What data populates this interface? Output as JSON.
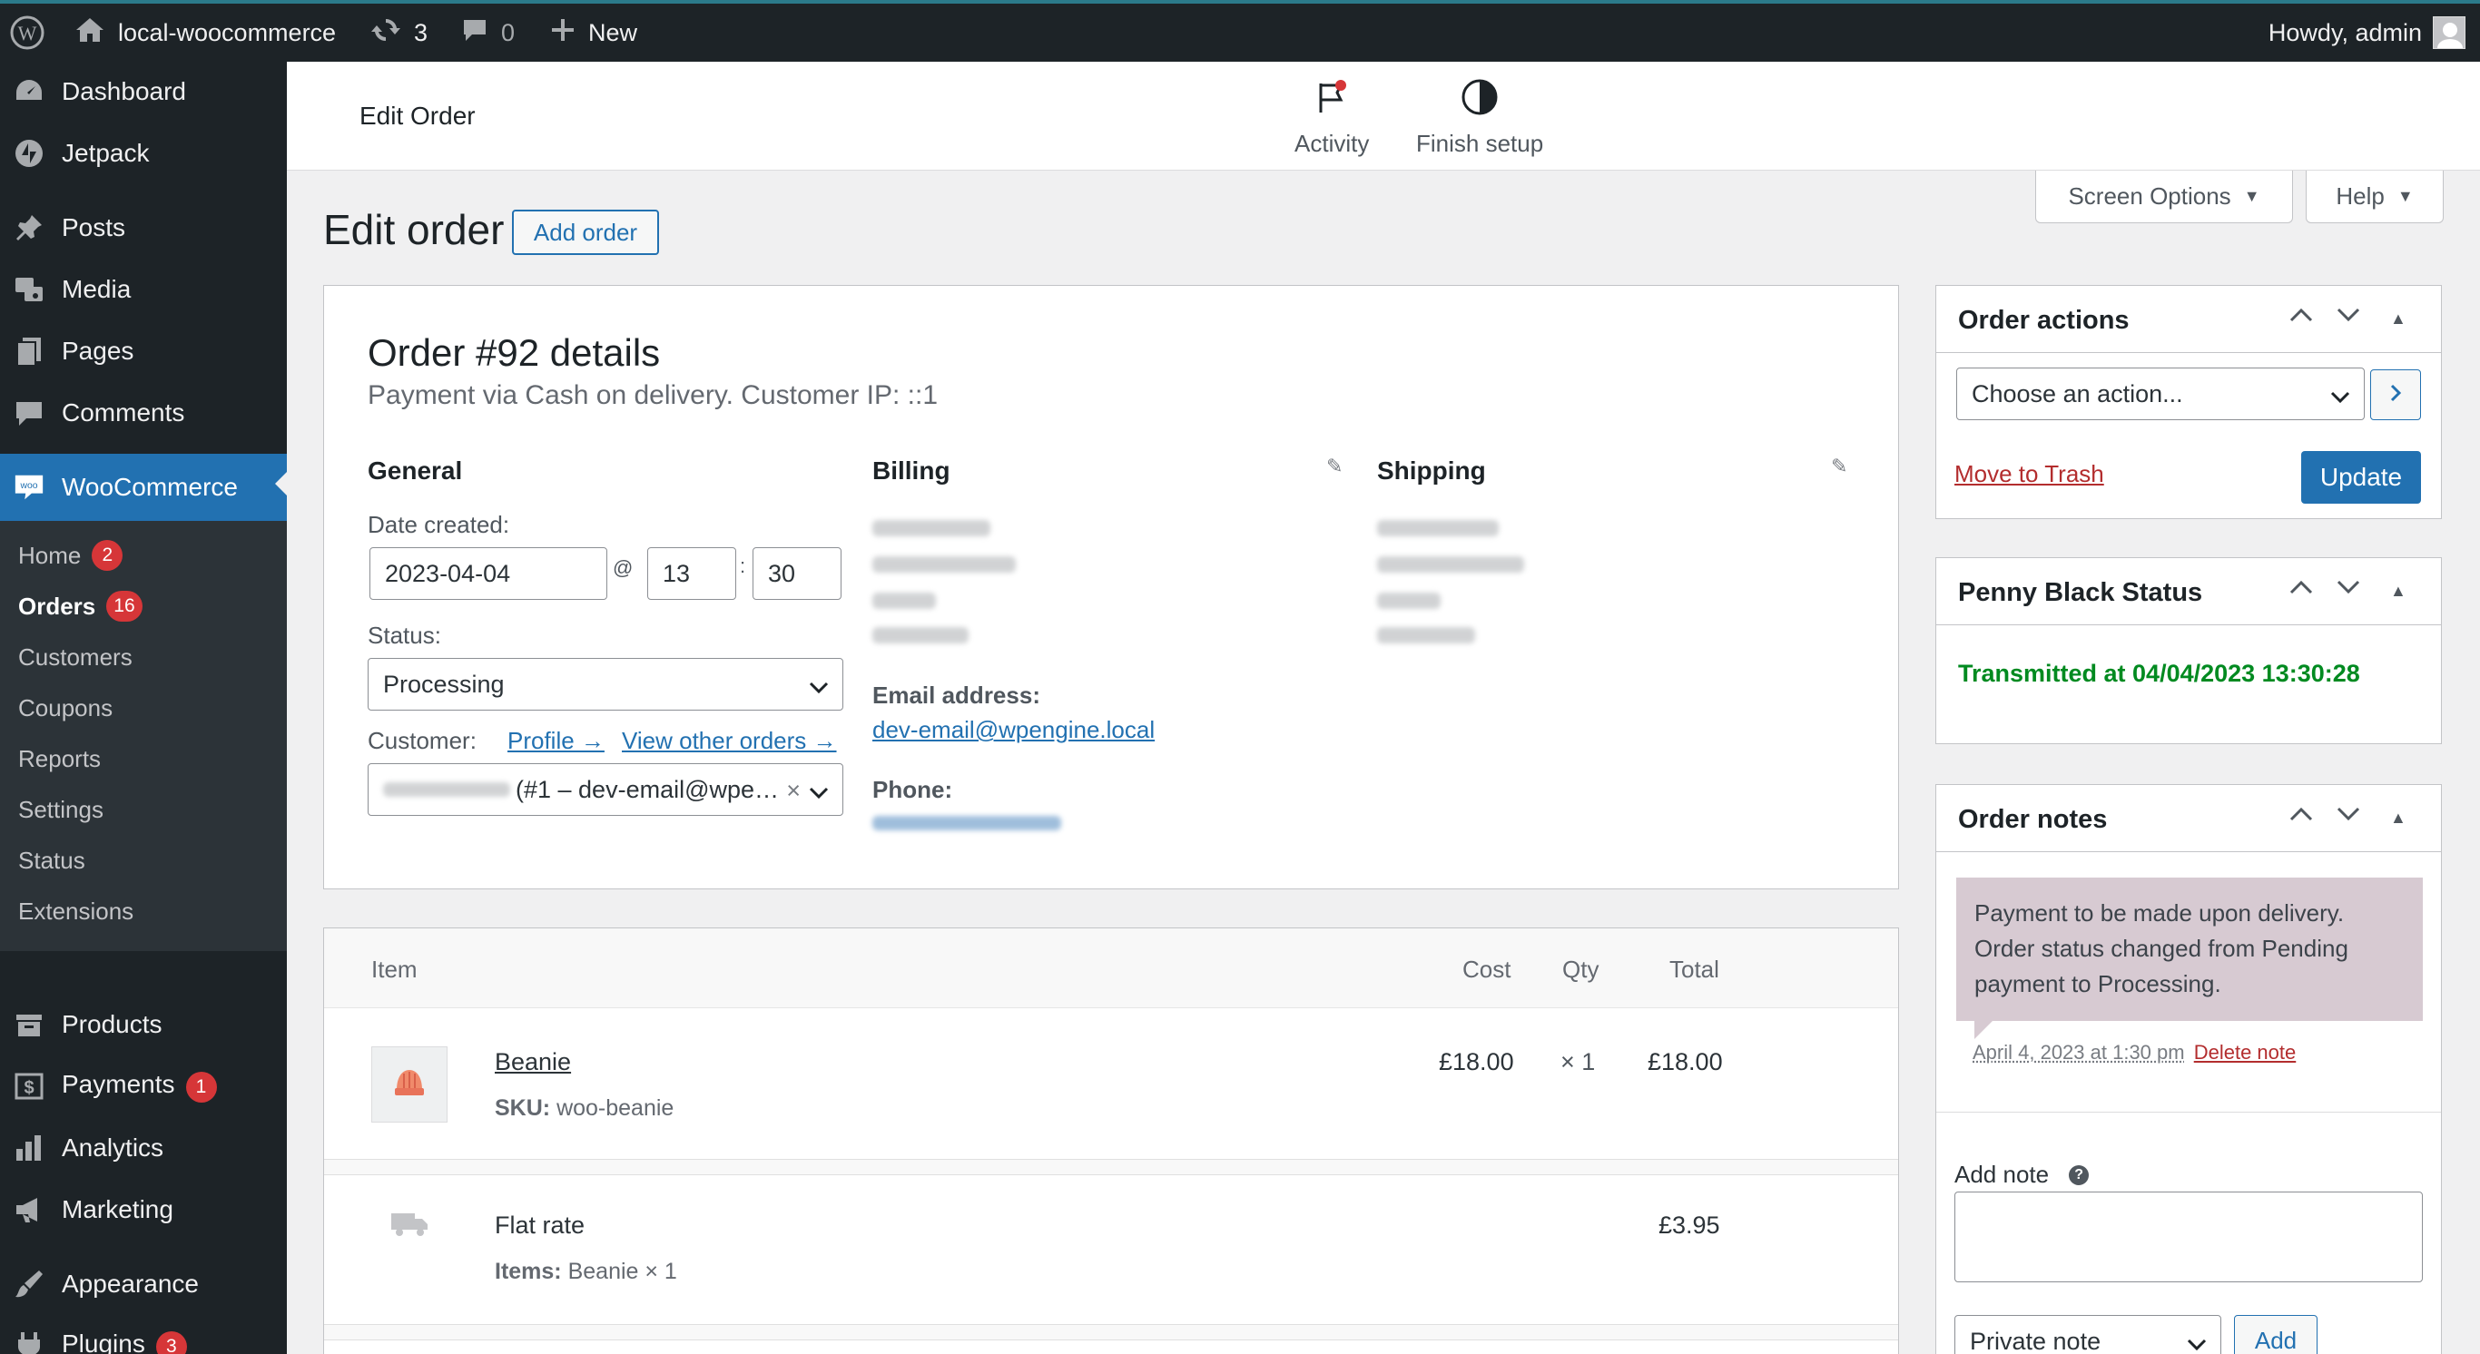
{
  "admin_bar": {
    "site_name": "local-woocommerce",
    "updates_count": "3",
    "comments_count": "0",
    "new_label": "New",
    "greeting": "Howdy, admin"
  },
  "sidebar": {
    "dashboard": "Dashboard",
    "jetpack": "Jetpack",
    "posts": "Posts",
    "media": "Media",
    "pages": "Pages",
    "comments": "Comments",
    "woocommerce": "WooCommerce",
    "submenu": {
      "home": "Home",
      "home_badge": "2",
      "orders": "Orders",
      "orders_badge": "16",
      "customers": "Customers",
      "coupons": "Coupons",
      "reports": "Reports",
      "settings": "Settings",
      "status": "Status",
      "extensions": "Extensions"
    },
    "products": "Products",
    "payments": "Payments",
    "payments_badge": "1",
    "analytics": "Analytics",
    "marketing": "Marketing",
    "appearance": "Appearance",
    "plugins": "Plugins",
    "plugins_badge": "3"
  },
  "header": {
    "title": "Edit Order",
    "activity": "Activity",
    "finish_setup": "Finish setup"
  },
  "screen_options": "Screen Options",
  "help": "Help",
  "page": {
    "heading": "Edit order",
    "add_order": "Add order"
  },
  "order": {
    "title": "Order #92 details",
    "subtitle": "Payment via Cash on delivery. Customer IP: ::1",
    "general": {
      "heading": "General",
      "date_label": "Date created:",
      "date": "2023-04-04",
      "at": "@",
      "hour": "13",
      "colon": ":",
      "minute": "30",
      "status_label": "Status:",
      "status": "Processing",
      "customer_label": "Customer:",
      "profile_link": "Profile →",
      "other_orders_link": "View other orders →",
      "customer_value": "(#1 – dev-email@wpe…",
      "clear": "×"
    },
    "billing": {
      "heading": "Billing",
      "email_label": "Email address:",
      "email": "dev-email@wpengine.local",
      "phone_label": "Phone:"
    },
    "shipping": {
      "heading": "Shipping"
    }
  },
  "items": {
    "headers": {
      "item": "Item",
      "cost": "Cost",
      "qty": "Qty",
      "total": "Total"
    },
    "product": {
      "name": "Beanie",
      "sku_label": "SKU:",
      "sku": "woo-beanie",
      "cost": "£18.00",
      "qty": "× 1",
      "total": "£18.00"
    },
    "shipping": {
      "name": "Flat rate",
      "items_label": "Items:",
      "items": "Beanie × 1",
      "total": "£3.95"
    }
  },
  "order_actions": {
    "title": "Order actions",
    "select": "Choose an action...",
    "trash": "Move to Trash",
    "update": "Update"
  },
  "penny_black": {
    "title": "Penny Black Status",
    "status": "Transmitted at 04/04/2023 13:30:28",
    "status_color": "#008a20"
  },
  "order_notes": {
    "title": "Order notes",
    "note_text": "Payment to be made upon delivery. Order status changed from Pending payment to Processing.",
    "note_meta": "April 4, 2023 at 1:30 pm",
    "delete": "Delete note",
    "add_note_label": "Add note",
    "note_type": "Private note",
    "add_button": "Add"
  },
  "colors": {
    "admin_bar_bg": "#1d2327",
    "accent": "#2271b1",
    "badge": "#d63638",
    "note_bg": "#d7cad2"
  }
}
